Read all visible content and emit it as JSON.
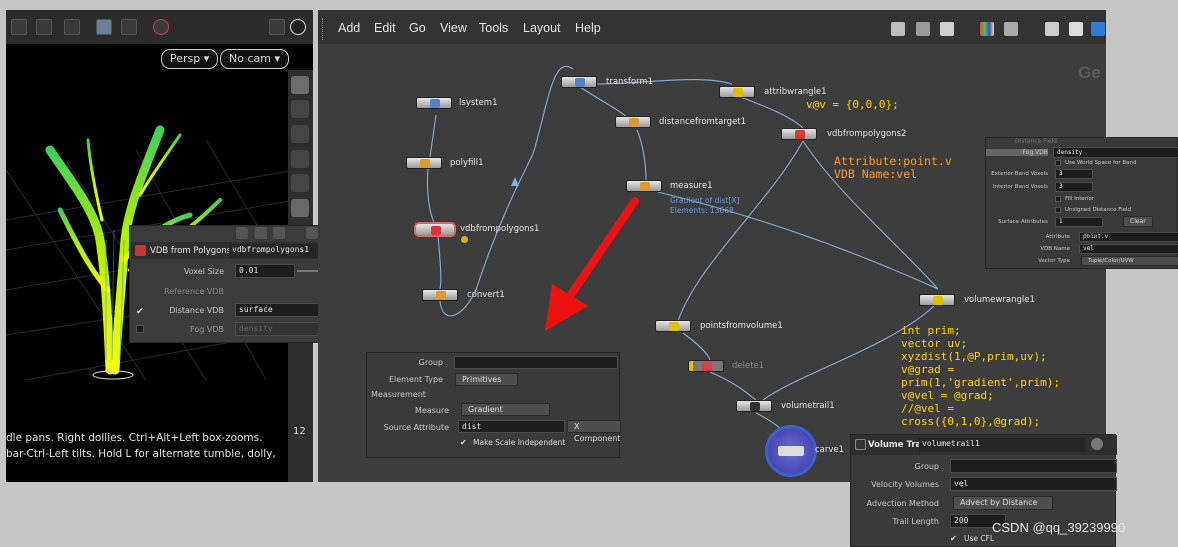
{
  "viewport": {
    "persp_label": "Persp ▾",
    "cam_label": "No cam ▾",
    "help_line1": "dle pans. Right dollies. Ctrl+Alt+Left box-zooms.",
    "help_line2": "bar-Ctrl-Left tilts. Hold L for alternate tumble, dolly,",
    "side_number": "12"
  },
  "network": {
    "menu": [
      "Add",
      "Edit",
      "Go",
      "View",
      "Tools",
      "Layout",
      "Help"
    ],
    "corner_text": "Ge",
    "nodes": {
      "lsystem1": "lsystem1",
      "polyfill1": "polyfill1",
      "vdbfrompolygons1": "vdbfrompolygons1",
      "convert1": "convert1",
      "transform1": "transform1",
      "distancefromtarget1": "distancefromtarget1",
      "attribwrangle1": "attribwrangle1",
      "vdbfrompolygons2": "vdbfrompolygons2",
      "measure1": "measure1",
      "pointsfromvolume1": "pointsfromvolume1",
      "delete1": "delete1",
      "volumetrail1": "volumetrail1",
      "volumewrangle1": "volumewrangle1",
      "carve1": "carve1"
    },
    "measure_info_line1": "Gradient of dist[X]",
    "measure_info_line2": "Elements: 13668",
    "code_attrib": "v@v = {0,0,0};",
    "note_attrib_line1": "Attribute:point.v",
    "note_attrib_line2": "VDB Name:vel",
    "code_wrangle": "int prim;\nvector uv;\nxyzdist(1,@P,prim,uv);\nv@grad =\nprim(1,'gradient',prim);\nv@vel = @grad;\n//@vel =\ncross({0,1,0},@grad);"
  },
  "vdb_panel": {
    "type_label": "VDB from Polygons",
    "name": "vdbfrompolygons1",
    "voxel_size_label": "Voxel Size",
    "voxel_size": "0.01",
    "reference_vdb_label": "Reference VDB",
    "distance_vdb_label": "Distance VDB",
    "distance_vdb": "surface",
    "fog_vdb_label": "Fog VDB",
    "fog_vdb": "density"
  },
  "measure_panel": {
    "group_label": "Group",
    "element_type_label": "Element Type",
    "element_type": "Primitives",
    "section": "Measurement",
    "measure_label": "Measure",
    "measure": "Gradient",
    "source_attr_label": "Source Attribute",
    "source_attr": "dist",
    "component": "X Component",
    "scale_label": "Make Scale Independent"
  },
  "vdb2_panel": {
    "distance_field": "Distance Field",
    "fog_label": "Fog VDB",
    "fog_value": "density",
    "world_space": "Use World Space for Band",
    "ext_band_label": "Exterior Band Voxels",
    "ext_band": "3",
    "int_band_label": "Interior Band Voxels",
    "int_band": "3",
    "fill_interior": "Fill Interior",
    "unsigned": "Unsigned Distance Field",
    "surface_attr_label": "Surface Attributes",
    "surface_attr": "1",
    "clear": "Clear",
    "attribute_label": "Attribute",
    "attribute": "point.v",
    "vdb_name_label": "VDB Name",
    "vdb_name": "vel",
    "vector_type_label": "Vector Type",
    "vector_type": "Tuple/Color/UVW"
  },
  "trail_panel": {
    "type_label": "Volume Trail",
    "name": "volumetrail1",
    "group_label": "Group",
    "velocity_label": "Velocity Volumes",
    "velocity": "vel",
    "method_label": "Advection Method",
    "method": "Advect by Distance",
    "trail_label": "Trail Length",
    "trail": "200",
    "cfl_label": "Use CFL"
  },
  "watermark": "CSDN @qq_39239990"
}
